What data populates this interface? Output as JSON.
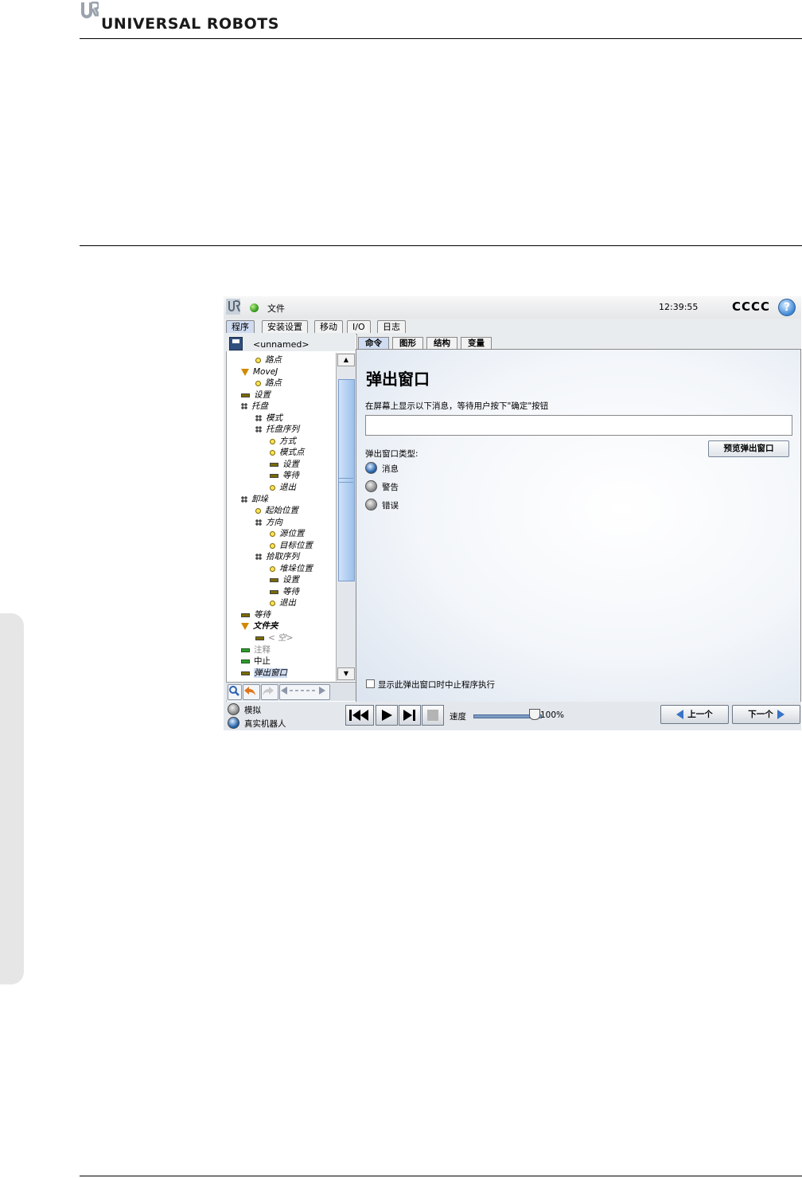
{
  "page": {
    "brand": "UNIVERSAL ROBOTS"
  },
  "window": {
    "file_menu": "文件",
    "clock": "12:39:55",
    "robot_name": "CCCC",
    "help": "?",
    "main_tabs": [
      "程序",
      "安装设置",
      "移动",
      "I/O",
      "日志"
    ],
    "active_main_tab": "程序"
  },
  "program": {
    "name": "<unnamed>",
    "tree": [
      {
        "label": "路点"
      },
      {
        "label": "MoveJ"
      },
      {
        "label": "路点"
      },
      {
        "label": "设置"
      },
      {
        "label": "托盘"
      },
      {
        "label": "模式"
      },
      {
        "label": "托盘序列"
      },
      {
        "label": "方式"
      },
      {
        "label": "模式点"
      },
      {
        "label": "设置"
      },
      {
        "label": "等待"
      },
      {
        "label": "退出"
      },
      {
        "label": "卸垛"
      },
      {
        "label": "起始位置"
      },
      {
        "label": "方向"
      },
      {
        "label": "源位置"
      },
      {
        "label": "目标位置"
      },
      {
        "label": "拾取序列"
      },
      {
        "label": "堆垛位置"
      },
      {
        "label": "设置"
      },
      {
        "label": "等待"
      },
      {
        "label": "退出"
      },
      {
        "label": "等待"
      },
      {
        "label": "文件夹"
      },
      {
        "label": "< 空>"
      },
      {
        "label": "注释"
      },
      {
        "label": "中止"
      },
      {
        "label": "弹出窗口"
      }
    ],
    "scroll_arrows": {
      "up": "▲",
      "down": "▼"
    }
  },
  "sub_tabs": [
    "命令",
    "图形",
    "结构",
    "变量"
  ],
  "active_sub_tab": "命令",
  "popup": {
    "title": "弹出窗口",
    "description": "在屏幕上显示以下消息，等待用户按下\"确定\"按钮",
    "message_value": "",
    "preview_button": "预览弹出窗口",
    "type_label": "弹出窗口类型:",
    "types": [
      {
        "label": "消息",
        "selected": true
      },
      {
        "label": "警告",
        "selected": false
      },
      {
        "label": "错误",
        "selected": false
      }
    ],
    "halt_label": "显示此弹出窗口时中止程序执行",
    "halt_checked": false
  },
  "bottom": {
    "simulate": "模拟",
    "real_robot": "真实机器人",
    "mode_selected": "真实机器人",
    "speed_label": "速度",
    "speed_value": "100%",
    "prev": "上一个",
    "next": "下一个"
  },
  "colors": {
    "accent_blue": "#3a73c6",
    "tab_active": "#cfdcf2",
    "status_green": "#2a8f12"
  }
}
